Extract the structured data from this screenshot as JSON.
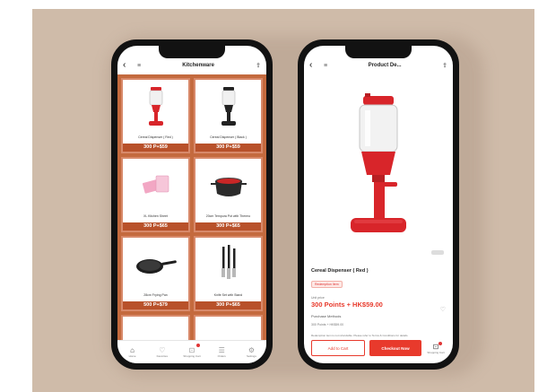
{
  "list_screen": {
    "title": "Kitchenware",
    "products": [
      {
        "name": "Cereal Dispenser ( Red )",
        "price": "300 P+$59",
        "image": "red-dispenser"
      },
      {
        "name": "Cereal Dispenser ( Black )",
        "price": "300 P+$59",
        "image": "black-dispenser"
      },
      {
        "name": "XL Kitchen Sheet",
        "price": "300 P+$65",
        "image": "pink-sheets"
      },
      {
        "name": "20cm Tempura Pot with Thermo",
        "price": "300 P+$65",
        "image": "black-pot"
      },
      {
        "name": "28cm Frying Pan",
        "price": "500 P+$79",
        "image": "frying-pan"
      },
      {
        "name": "Knife Set with Stand",
        "price": "300 P+$65",
        "image": "knives"
      },
      {
        "name": "",
        "price": "",
        "image": "grill-pan"
      },
      {
        "name": "",
        "price": "",
        "image": "pan-lid"
      }
    ],
    "tabs": [
      {
        "label": "Home",
        "icon": "home-icon"
      },
      {
        "label": "Favorites",
        "icon": "heart-icon"
      },
      {
        "label": "Shopping Cart",
        "icon": "cart-icon"
      },
      {
        "label": "Orders",
        "icon": "orders-icon"
      },
      {
        "label": "Settings",
        "icon": "gear-icon"
      }
    ]
  },
  "detail_screen": {
    "title": "Product De...",
    "product_name": "Cereal Dispenser ( Red )",
    "tag": "Redemption Item",
    "points_label": "Unit price",
    "points_price": "300 Points + HK$59.00",
    "payment_label": "Purchase Methods",
    "payment_value": "300 Points + HK$59.00",
    "note": "Redemption item is not refundable. Please refer to Terms & Conditions for details.",
    "add_to_cart": "Add to Cart",
    "checkout": "Checkout Now",
    "cart_label": "Shopping Cart"
  },
  "colors": {
    "grid_bg": "#c46a3e",
    "price_bar": "#b8512a",
    "accent": "#e83a2c",
    "backdrop": "#cfbba9"
  }
}
